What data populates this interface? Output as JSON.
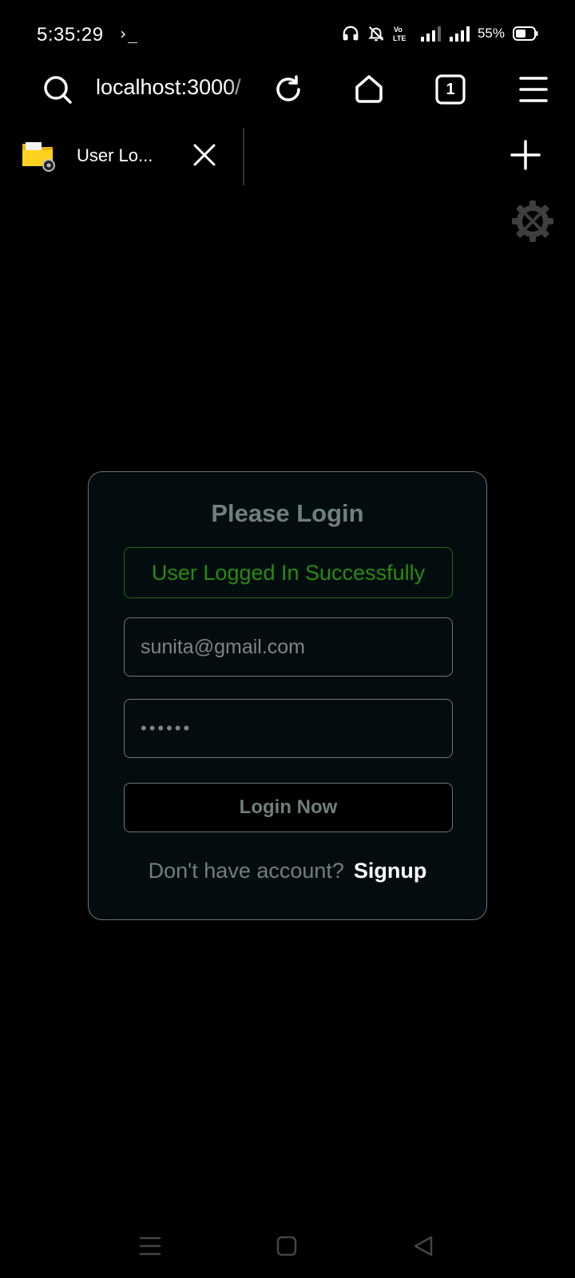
{
  "status_bar": {
    "time": "5:35:29",
    "terminal_glyph": "›_",
    "battery_percent": "55%"
  },
  "browser": {
    "url": "localhost:3000/",
    "tab_count": "1",
    "tab_title": "User Lo..."
  },
  "login_card": {
    "title": "Please Login",
    "alert_message": "User Logged In Successfully",
    "email_value": "sunita@gmail.com",
    "password_value": "••••••",
    "login_button": "Login Now",
    "signup_prompt": "Don't have account?",
    "signup_link": "Signup"
  },
  "colors": {
    "background": "#000000",
    "card_background": "#030d0f",
    "success_green": "#2a8a12",
    "muted_text": "#6f7f7d"
  }
}
